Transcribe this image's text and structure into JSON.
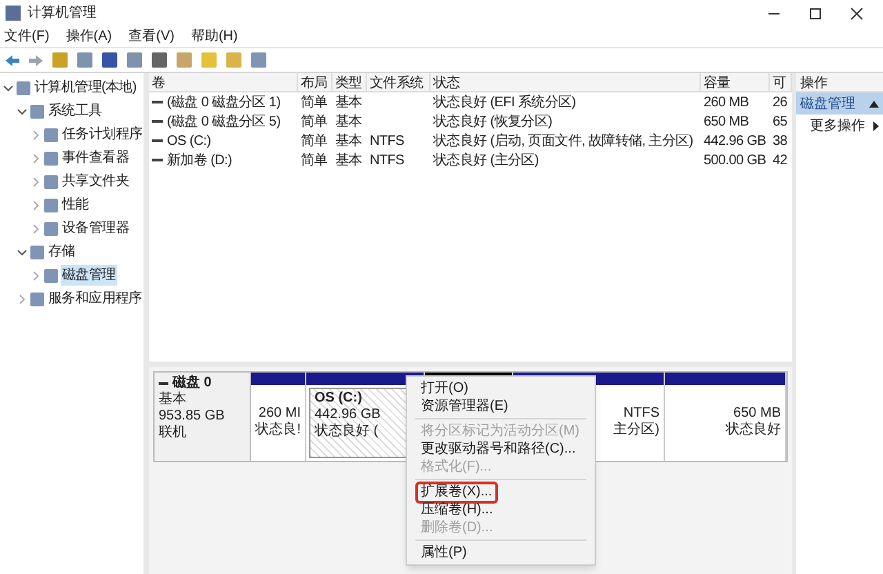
{
  "window": {
    "title": "计算机管理"
  },
  "menu": [
    "文件(F)",
    "操作(A)",
    "查看(V)",
    "帮助(H)"
  ],
  "tree": [
    {
      "label": "计算机管理(本地)",
      "selected": false,
      "expanded": true,
      "children": [
        {
          "label": "系统工具",
          "selected": false,
          "expanded": true,
          "children": [
            {
              "label": "任务计划程序",
              "selected": false,
              "expanded": false
            },
            {
              "label": "事件查看器",
              "selected": false,
              "expanded": false
            },
            {
              "label": "共享文件夹",
              "selected": false,
              "expanded": false
            },
            {
              "label": "性能",
              "selected": false,
              "expanded": false
            },
            {
              "label": "设备管理器",
              "selected": false,
              "expanded": false
            }
          ]
        },
        {
          "label": "存储",
          "selected": false,
          "expanded": true,
          "children": [
            {
              "label": "磁盘管理",
              "selected": true,
              "expanded": false
            }
          ]
        },
        {
          "label": "服务和应用程序",
          "selected": false,
          "expanded": false
        }
      ]
    }
  ],
  "table": {
    "columns": [
      "卷",
      "布局",
      "类型",
      "文件系统",
      "状态",
      "容量",
      "可"
    ],
    "rows": [
      [
        "(磁盘 0 磁盘分区 1)",
        "简单",
        "基本",
        "",
        "状态良好 (EFI 系统分区)",
        "260 MB",
        "26"
      ],
      [
        "(磁盘 0 磁盘分区 5)",
        "简单",
        "基本",
        "",
        "状态良好 (恢复分区)",
        "650 MB",
        "65"
      ],
      [
        "OS (C:)",
        "简单",
        "基本",
        "NTFS",
        "状态良好 (启动, 页面文件, 故障转储, 主分区)",
        "442.96 GB",
        "38"
      ],
      [
        "新加卷 (D:)",
        "简单",
        "基本",
        "NTFS",
        "状态良好 (主分区)",
        "500.00 GB",
        "42"
      ]
    ]
  },
  "actions": {
    "title": "操作",
    "section": "磁盘管理",
    "items": [
      "更多操作"
    ]
  },
  "disk": {
    "name": "磁盘 0",
    "lines": [
      "基本",
      "953.85 GB",
      "联机"
    ],
    "partitions": [
      {
        "kind": "primary",
        "selected": false,
        "lines": [
          "260 MI",
          "状态良!"
        ]
      },
      {
        "kind": "primary",
        "selected": true,
        "lines": [
          "OS  (C:)",
          "442.96 GB",
          "状态良好 ("
        ]
      },
      {
        "kind": "unallocated"
      },
      {
        "kind": "primary",
        "selected": false,
        "lines": [
          "NTFS",
          "主分区)"
        ]
      },
      {
        "kind": "primary",
        "selected": false,
        "lines": [
          "650 MB",
          "状态良好"
        ]
      }
    ]
  },
  "context_menu": [
    {
      "kind": "item",
      "label": "打开(O)",
      "disabled": false,
      "highlighted": false
    },
    {
      "kind": "item",
      "label": "资源管理器(E)",
      "disabled": false,
      "highlighted": false
    },
    {
      "kind": "separator"
    },
    {
      "kind": "item",
      "label": "将分区标记为活动分区(M)",
      "disabled": true,
      "highlighted": false
    },
    {
      "kind": "item",
      "label": "更改驱动器号和路径(C)...",
      "disabled": false,
      "highlighted": false
    },
    {
      "kind": "item",
      "label": "格式化(F)...",
      "disabled": true,
      "highlighted": false
    },
    {
      "kind": "separator"
    },
    {
      "kind": "item",
      "label": "扩展卷(X)...",
      "disabled": false,
      "highlighted": true
    },
    {
      "kind": "item",
      "label": "压缩卷(H)...",
      "disabled": false,
      "highlighted": false
    },
    {
      "kind": "item",
      "label": "删除卷(D)...",
      "disabled": true,
      "highlighted": false
    },
    {
      "kind": "separator"
    },
    {
      "kind": "item",
      "label": "属性(P)",
      "disabled": false,
      "highlighted": false
    }
  ]
}
